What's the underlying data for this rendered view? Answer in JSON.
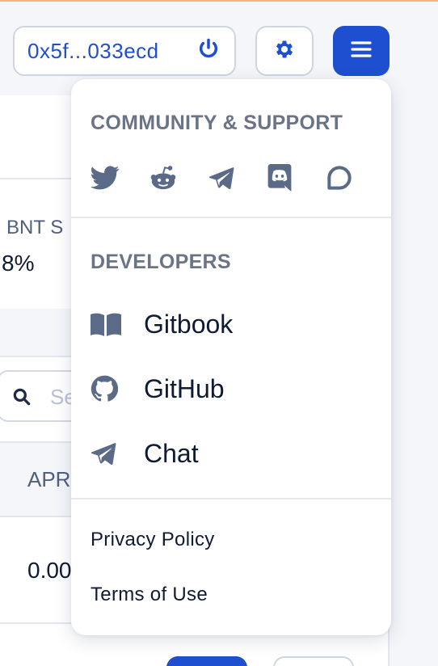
{
  "header": {
    "wallet_address": "0x5f...033ecd",
    "wallet_icon": "power-icon",
    "settings_icon": "gear-icon",
    "menu_icon": "hamburger-icon"
  },
  "background": {
    "stat_label": "BNT S",
    "stat_value": "8%",
    "search_placeholder": "Se",
    "column_header": "APR",
    "cell_value": "0.00"
  },
  "dropdown": {
    "community_title": "COMMUNITY & SUPPORT",
    "social_icons": [
      "twitter-icon",
      "reddit-icon",
      "telegram-icon",
      "discord-icon",
      "forum-icon"
    ],
    "developers_title": "DEVELOPERS",
    "developer_links": [
      {
        "label": "Gitbook",
        "icon": "book-icon"
      },
      {
        "label": "GitHub",
        "icon": "github-icon"
      },
      {
        "label": "Chat",
        "icon": "telegram-icon"
      }
    ],
    "privacy_label": "Privacy Policy",
    "terms_label": "Terms of Use"
  },
  "colors": {
    "brand_blue": "#1d4fd0",
    "icon_gray": "#5b6a86",
    "title_gray": "#6b7486"
  }
}
